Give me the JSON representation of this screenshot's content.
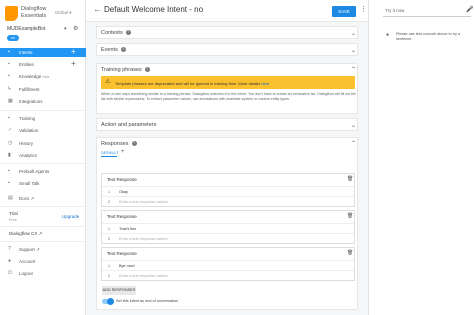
{
  "brand": {
    "name": "Dialogflow Essentials",
    "region": "Global"
  },
  "agent": {
    "name": "MUDExampleBot",
    "language": "en"
  },
  "nav": [
    {
      "label": "Intents",
      "icon": "chat-bubble-icon",
      "active": true,
      "plus": "+"
    },
    {
      "label": "Entities",
      "icon": "entity-icon",
      "plus": "+"
    },
    {
      "label": "Knowledge",
      "icon": "knowledge-icon",
      "beta": "beta"
    },
    {
      "label": "Fulfillment",
      "icon": "bolt-icon"
    },
    {
      "label": "Integrations",
      "icon": "integrations-icon"
    },
    {
      "label": "Training",
      "icon": "training-icon"
    },
    {
      "label": "Validation",
      "icon": "check-icon"
    },
    {
      "label": "History",
      "icon": "clock-icon"
    },
    {
      "label": "Analytics",
      "icon": "chart-icon"
    },
    {
      "label": "Prebuilt Agents",
      "icon": "agent-icon"
    },
    {
      "label": "Small Talk",
      "icon": "smalltalk-icon"
    },
    {
      "label": "Docs",
      "icon": "doc-icon",
      "ext": "↗"
    }
  ],
  "trial": {
    "title": "Trial",
    "subtitle": "Free",
    "upgrade": "Upgrade"
  },
  "cx": {
    "label": "Dialogflow CX",
    "ext": "↗"
  },
  "footer_nav": [
    {
      "label": "Support",
      "icon": "help-icon",
      "ext": "↗"
    },
    {
      "label": "Account",
      "icon": "account-icon"
    },
    {
      "label": "Logout",
      "icon": "logout-icon"
    }
  ],
  "header": {
    "back": "←",
    "title": "Default Welcome Intent - no",
    "save": "SAVE",
    "more": "⋮"
  },
  "sections": {
    "contexts": "Contexts",
    "events": "Events",
    "training": "Training phrases",
    "action": "Action and parameters",
    "responses": "Responses"
  },
  "warning": {
    "text": "Template phrases are deprecated and will be ignored in training time. More details ",
    "link": "here"
  },
  "training_desc": "When a user says something similar to a training phrase, Dialogflow matches it to the intent. You don't have to create an exhaustive list. Dialogflow will fill out the list with similar expressions. To extract parameter values, use annotations with available system or custom entity types.",
  "responses": {
    "tab": "DEFAULT",
    "plus": "+",
    "cards": [
      {
        "title": "Text Response",
        "value": "Okay",
        "placeholder": "Enter a text response variant"
      },
      {
        "title": "Text Response",
        "value": "That's fine",
        "placeholder": "Enter a text response variant"
      },
      {
        "title": "Text Response",
        "value": "Bye now!",
        "placeholder": "Enter a text response variant"
      }
    ],
    "row1": "1",
    "row2": "2",
    "add": "ADD RESPONSES",
    "toggle_label": "Set this intent as end of conversation"
  },
  "right": {
    "try": "Try it now",
    "hint": "Please use test console above to try a sentence."
  },
  "colors": {
    "accent": "#1e88e5",
    "warning": "#fbc02d",
    "sidebar_active": "#2196f3"
  }
}
